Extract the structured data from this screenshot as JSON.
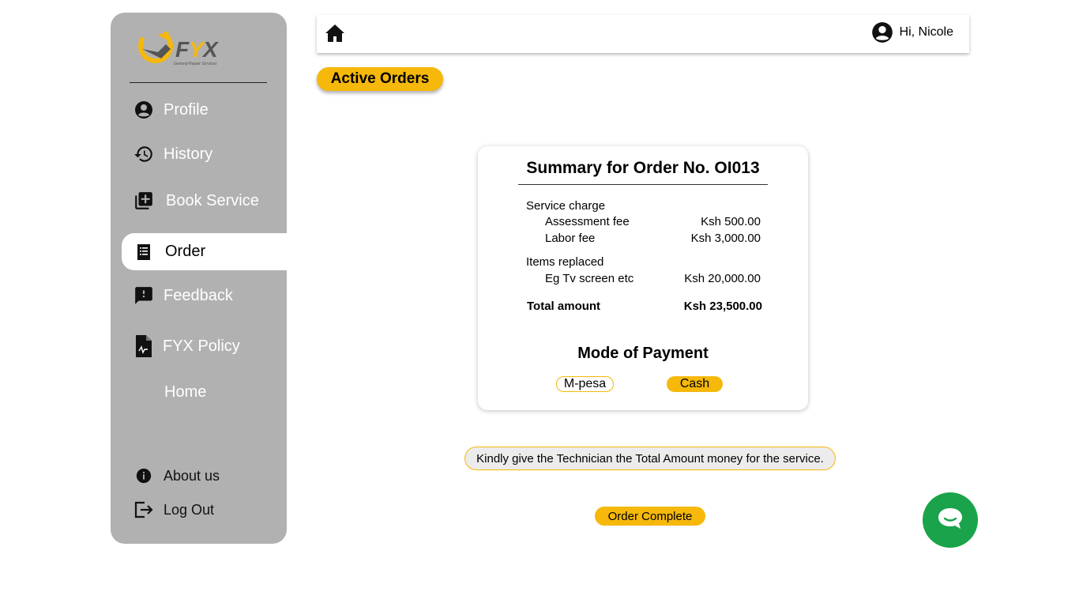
{
  "brand": {
    "name": "FYX",
    "tagline": "General Repair Services"
  },
  "sidebar": {
    "items": [
      {
        "label": "Profile",
        "icon": "account-circle-icon"
      },
      {
        "label": "History",
        "icon": "history-icon"
      },
      {
        "label": "Book Service",
        "icon": "library-add-icon"
      },
      {
        "label": "Order",
        "icon": "receipt-icon",
        "active": true
      },
      {
        "label": "Feedback",
        "icon": "feedback-icon"
      },
      {
        "label": "FYX Policy",
        "icon": "policy-document-icon"
      },
      {
        "label": "Home"
      }
    ],
    "bottom": [
      {
        "label": "About us",
        "icon": "info-icon"
      },
      {
        "label": "Log Out",
        "icon": "logout-icon"
      }
    ]
  },
  "topbar": {
    "greeting": "Hi, Nicole"
  },
  "page": {
    "section_label": "Active Orders"
  },
  "summary": {
    "title": "Summary for Order No. OI013",
    "service_charge_label": "Service charge",
    "assessment_label": "Assessment fee",
    "assessment_amount": "Ksh 500.00",
    "labor_label": "Labor fee",
    "labor_amount": "Ksh 3,000.00",
    "items_label": "Items replaced",
    "item_label": "Eg Tv screen etc",
    "item_amount": "Ksh 20,000.00",
    "total_label": "Total amount",
    "total_amount": "Ksh 23,500.00",
    "payment_title": "Mode of Payment",
    "payment_options": [
      "M-pesa",
      "Cash"
    ],
    "selected_payment": "Cash"
  },
  "notice": "Kindly give the Technician the Total Amount money for the service.",
  "complete_button": "Order Complete",
  "colors": {
    "accent": "#f5b80b",
    "sidebar": "#b1b1b1",
    "chat": "#1aa34a"
  }
}
